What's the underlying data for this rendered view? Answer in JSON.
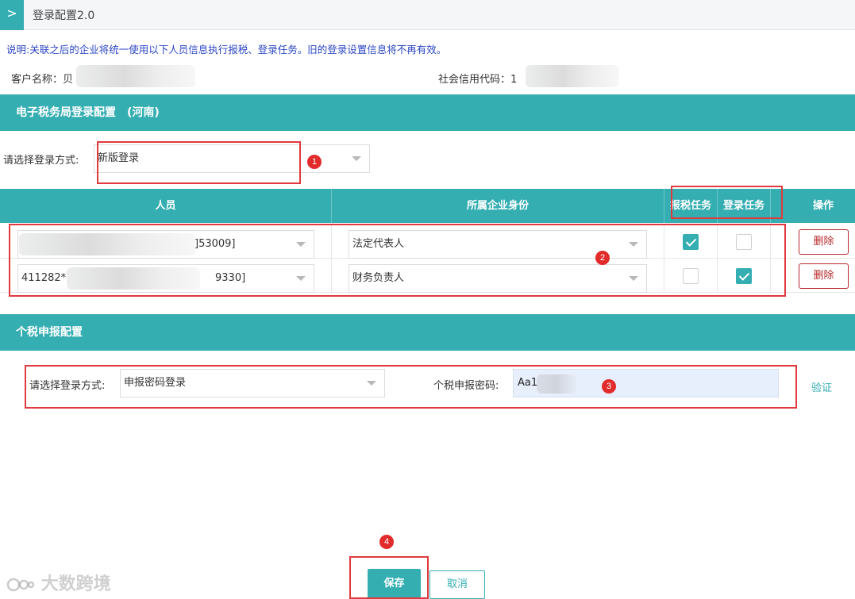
{
  "header": {
    "chevron": ">",
    "title": "登录配置2.0"
  },
  "notice": "说明:关联之后的企业将统一使用以下人员信息执行报税、登录任务。旧的登录设置信息将不再有效。",
  "customer": {
    "name_label": "客户名称：",
    "name_value": "贝",
    "credit_label": "社会信用代码：",
    "credit_value": "1"
  },
  "etax": {
    "title": "电子税务局登录配置　(河南)",
    "method_label": "请选择登录方式:",
    "method_value": "新版登录"
  },
  "table": {
    "headers": {
      "person": "人员",
      "identity": "所属企业身份",
      "tax_task": "报税任务",
      "login_task": "登录任务",
      "action": "操作"
    },
    "rows": [
      {
        "person": "]53009]",
        "identity": "法定代表人",
        "tax_task": true,
        "login_task": false,
        "delete_label": "删除"
      },
      {
        "person_prefix": "411282*",
        "person_suffix": "9330]",
        "identity": "财务负责人",
        "tax_task": false,
        "login_task": true,
        "delete_label": "删除"
      }
    ]
  },
  "iit": {
    "title": "个税申报配置",
    "method_label": "请选择登录方式:",
    "method_value": "申报密码登录",
    "password_label": "个税申报密码:",
    "password_value": "Aa1",
    "verify_label": "验证"
  },
  "buttons": {
    "save": "保存",
    "cancel": "取消"
  },
  "badges": [
    "1",
    "2",
    "3",
    "4"
  ],
  "watermark": "大数跨境",
  "colors": {
    "teal": "#35aeb2",
    "red": "#e0393e",
    "notice_blue": "#2b45c4"
  }
}
